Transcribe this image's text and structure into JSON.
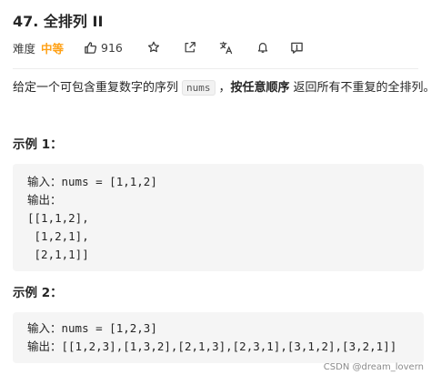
{
  "problem": {
    "title": "47. 全排列 II",
    "difficulty_label": "难度",
    "difficulty": "中等",
    "likes": "916"
  },
  "toolbar": {
    "icons": [
      "thumbs-up-icon",
      "star-icon",
      "share-icon",
      "translate-icon",
      "bell-icon",
      "feedback-icon"
    ]
  },
  "description": {
    "before": "给定一个可包含重复数字的序列",
    "code": "nums",
    "middle": "，",
    "bold": "按任意顺序",
    "after": "返回所有不重复的全排列。"
  },
  "examples": [
    {
      "title": "示例 1：",
      "lines": [
        "输入：nums = [1,1,2]",
        "输出：",
        "[[1,1,2],",
        " [1,2,1],",
        " [2,1,1]]"
      ]
    },
    {
      "title": "示例 2：",
      "lines": [
        "输入：nums = [1,2,3]",
        "输出：[[1,2,3],[1,3,2],[2,1,3],[2,3,1],[3,1,2],[3,2,1]]"
      ]
    }
  ],
  "watermark": "CSDN @dream_lovern",
  "colors": {
    "difficulty_medium": "#ffa116",
    "code_background": "#f5f5f5"
  }
}
